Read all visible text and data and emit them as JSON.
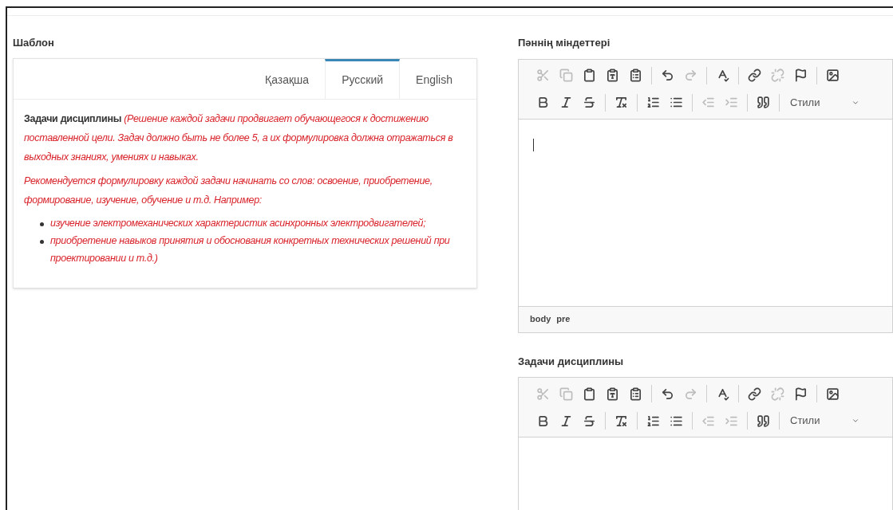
{
  "template": {
    "title": "Шаблон",
    "tabs": [
      {
        "label": "Қазақша",
        "selected": false
      },
      {
        "label": "Русский",
        "selected": true
      },
      {
        "label": "English",
        "selected": false
      }
    ],
    "paragraphs": [
      "**Задачи дисциплины** *(Решение каждой задачи продвигает обучающегося к достижению поставленной цели. Задач должно быть не более 5, а их формулировка должна отражаться в выходных знаниях, умениях и навыках.*",
      "*Рекомендуется формулировку каждой задачи начинать со слов: освоение, приобретение, формирование, изучение, обучение и т.д. Например:*"
    ],
    "bullets": [
      "изучение электромеханических характеристик асинхронных электродвигателей;",
      "приобретение навыков принятия и обоснования конкретных технических решений при проектировании и т.д.)"
    ]
  },
  "editors": [
    {
      "label": "Пәннің міндеттері",
      "path": [
        "body",
        "pre"
      ],
      "cursor": true,
      "styles": "Стили"
    },
    {
      "label": "Задачи дисциплины",
      "styles": "Стили"
    }
  ],
  "toolbar_row1": [
    {
      "kind": "cut",
      "disabled": true
    },
    {
      "kind": "copy",
      "disabled": true
    },
    {
      "kind": "paste",
      "disabled": false
    },
    {
      "kind": "paste-text",
      "disabled": false
    },
    {
      "kind": "paste-word",
      "disabled": false
    },
    {
      "kind": "sep"
    },
    {
      "kind": "undo",
      "disabled": false
    },
    {
      "kind": "redo",
      "disabled": true
    },
    {
      "kind": "sep"
    },
    {
      "kind": "spellcheck",
      "disabled": false
    },
    {
      "kind": "sep"
    },
    {
      "kind": "link",
      "disabled": false
    },
    {
      "kind": "unlink",
      "disabled": true
    },
    {
      "kind": "anchor",
      "disabled": false
    },
    {
      "kind": "sep"
    },
    {
      "kind": "image",
      "disabled": false
    }
  ],
  "toolbar_row2": [
    {
      "kind": "bold",
      "disabled": false
    },
    {
      "kind": "italic",
      "disabled": false
    },
    {
      "kind": "strike",
      "disabled": false
    },
    {
      "kind": "sep"
    },
    {
      "kind": "clear-format",
      "disabled": false
    },
    {
      "kind": "sep"
    },
    {
      "kind": "numbered-list",
      "disabled": false
    },
    {
      "kind": "bulleted-list",
      "disabled": false
    },
    {
      "kind": "sep"
    },
    {
      "kind": "outdent",
      "disabled": true
    },
    {
      "kind": "indent",
      "disabled": true
    },
    {
      "kind": "sep"
    },
    {
      "kind": "quote",
      "disabled": false
    },
    {
      "kind": "sep"
    }
  ]
}
